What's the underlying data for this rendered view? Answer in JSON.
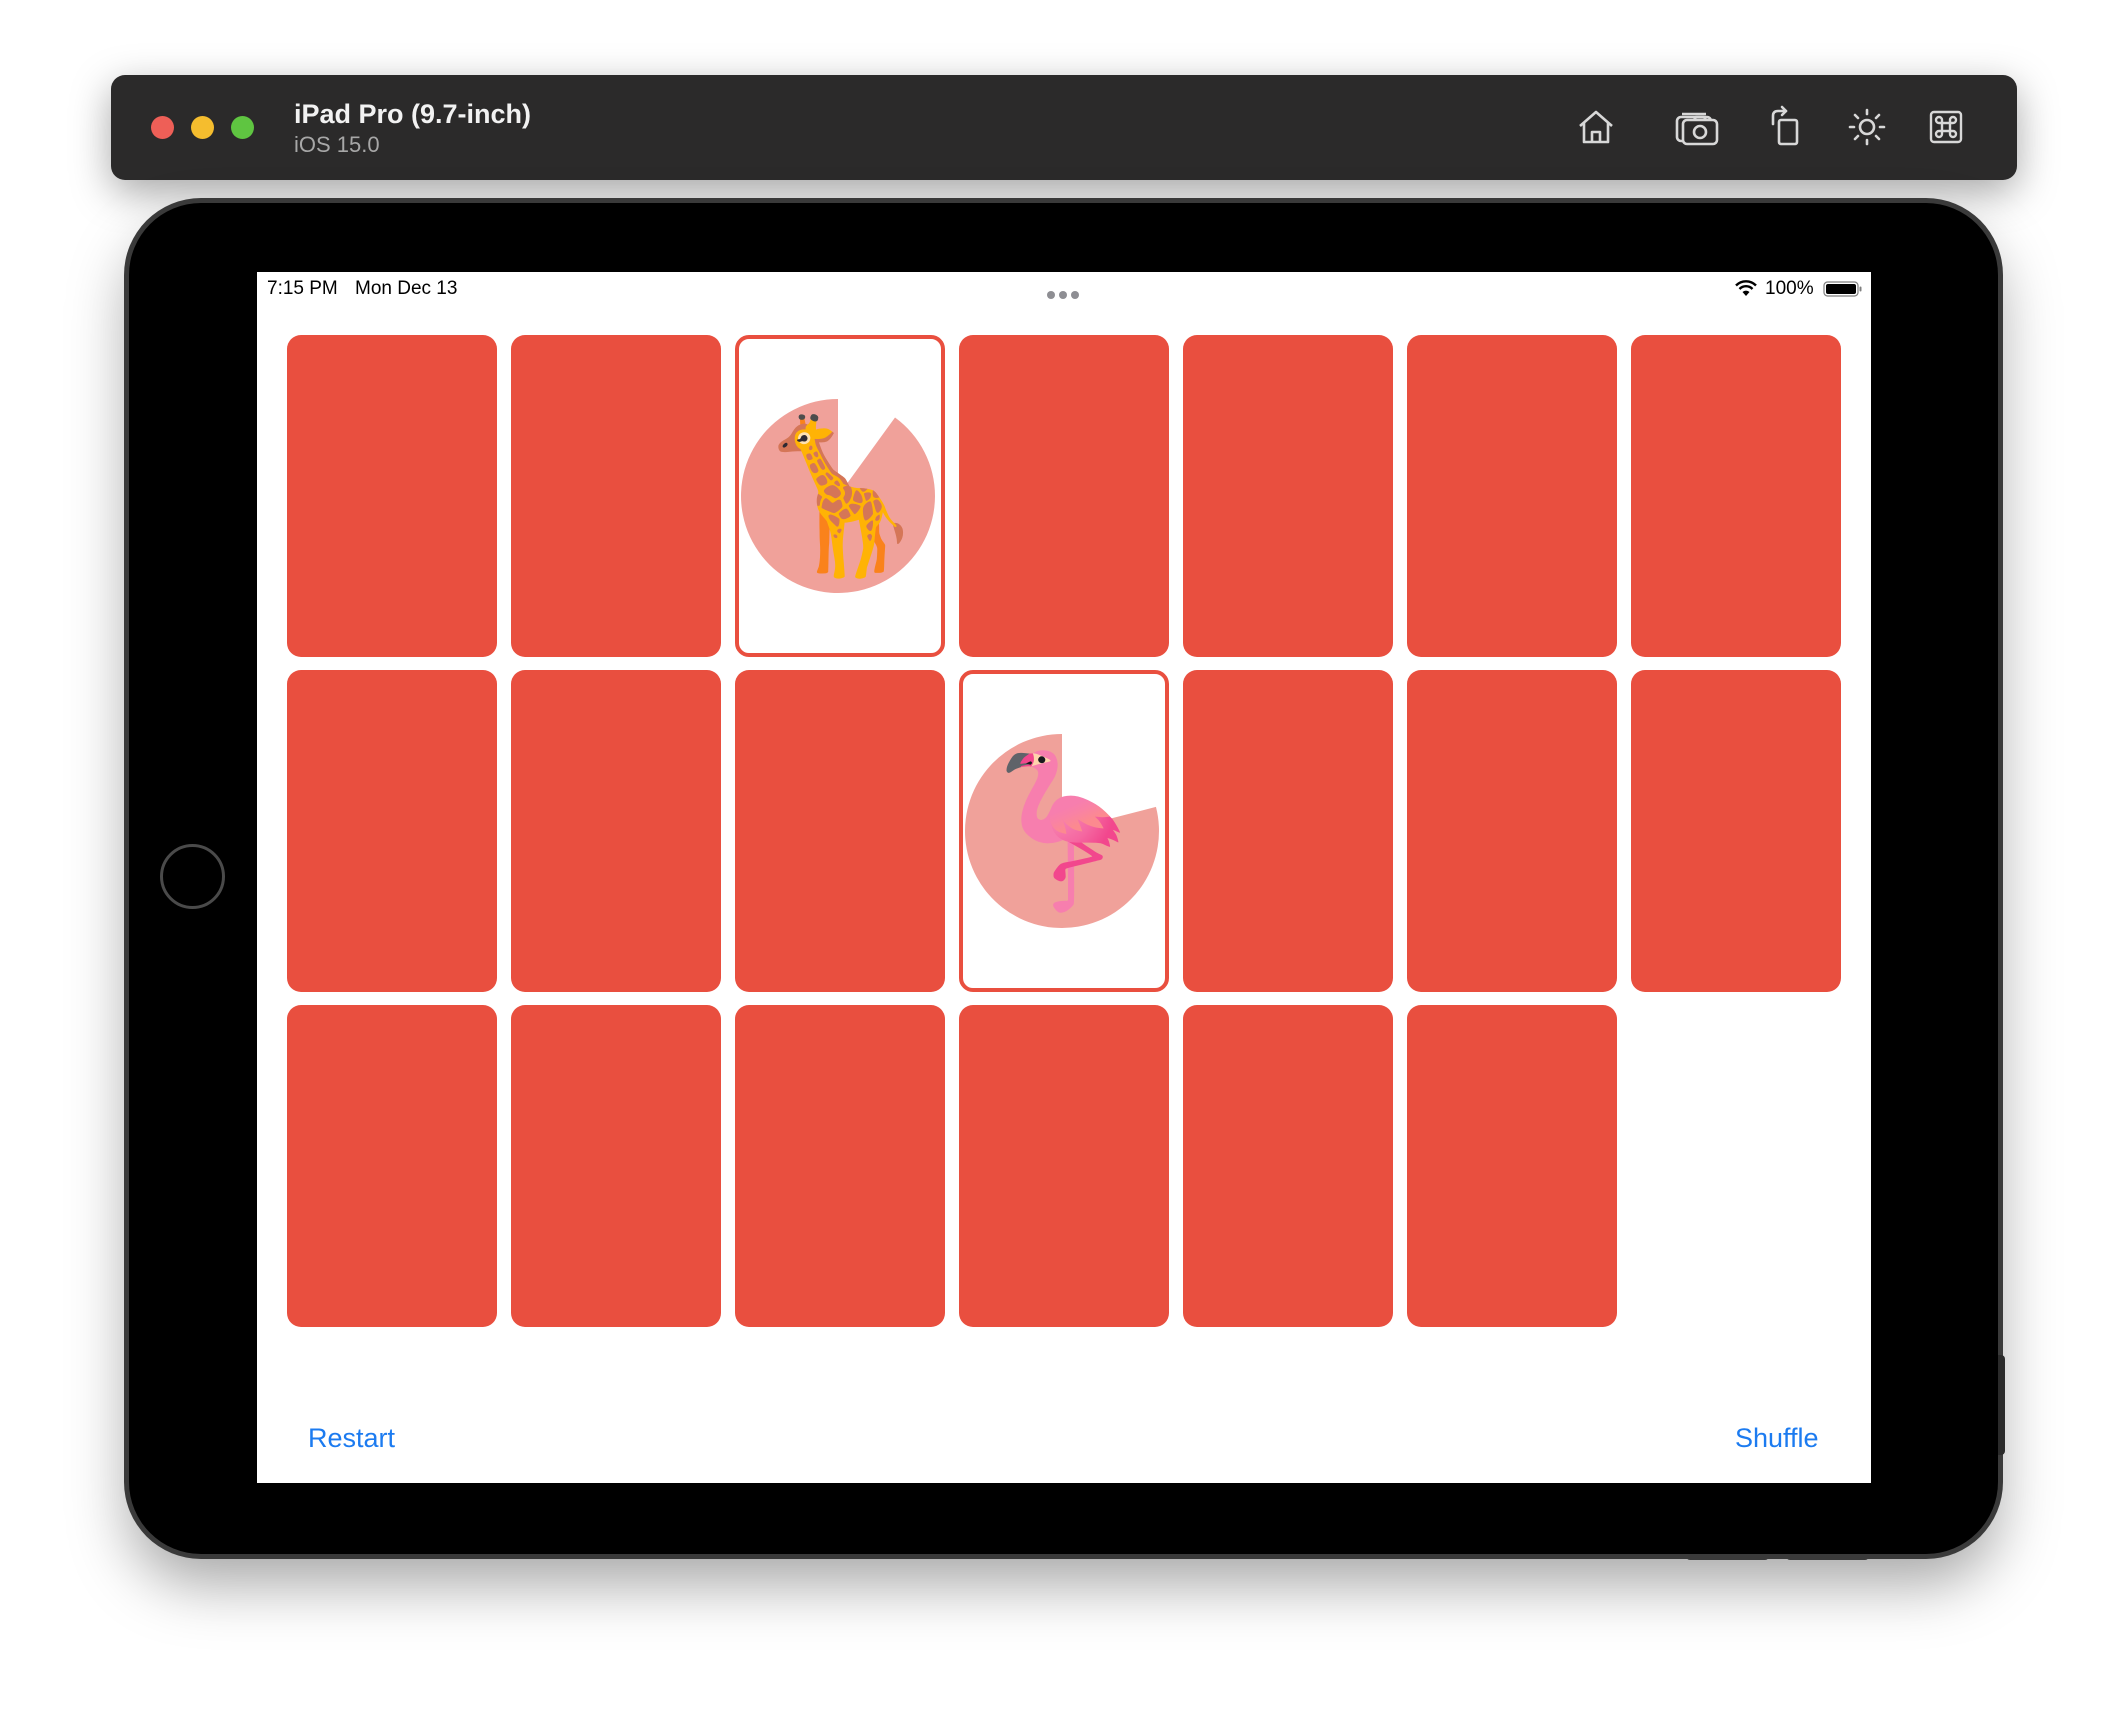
{
  "window": {
    "device_name": "iPad Pro (9.7-inch)",
    "os_version": "iOS 15.0",
    "toolbar_icons": [
      "home-icon",
      "screenshot-camera-icon",
      "rotate-icon",
      "brightness-icon",
      "command-icon"
    ]
  },
  "status_bar": {
    "time": "7:15 PM",
    "date": "Mon Dec 13",
    "battery": "100%",
    "icons": [
      "wifi-icon",
      "battery-icon"
    ]
  },
  "colors": {
    "card_back": "#e94f3f",
    "card_border": "#e94f3f",
    "pie": "#f0a19a",
    "link": "#1c7bf0"
  },
  "cards": [
    {
      "face_up": false
    },
    {
      "face_up": false
    },
    {
      "face_up": true,
      "emoji": "🦒",
      "pie_remaining": 0.9
    },
    {
      "face_up": false
    },
    {
      "face_up": false
    },
    {
      "face_up": false
    },
    {
      "face_up": false
    },
    {
      "face_up": false
    },
    {
      "face_up": false
    },
    {
      "face_up": false
    },
    {
      "face_up": true,
      "emoji": "🦩",
      "pie_remaining": 0.79
    },
    {
      "face_up": false
    },
    {
      "face_up": false
    },
    {
      "face_up": false
    },
    {
      "face_up": false
    },
    {
      "face_up": false
    },
    {
      "face_up": false
    },
    {
      "face_up": false
    },
    {
      "face_up": false
    },
    {
      "face_up": false
    }
  ],
  "footer": {
    "restart_label": "Restart",
    "shuffle_label": "Shuffle"
  }
}
